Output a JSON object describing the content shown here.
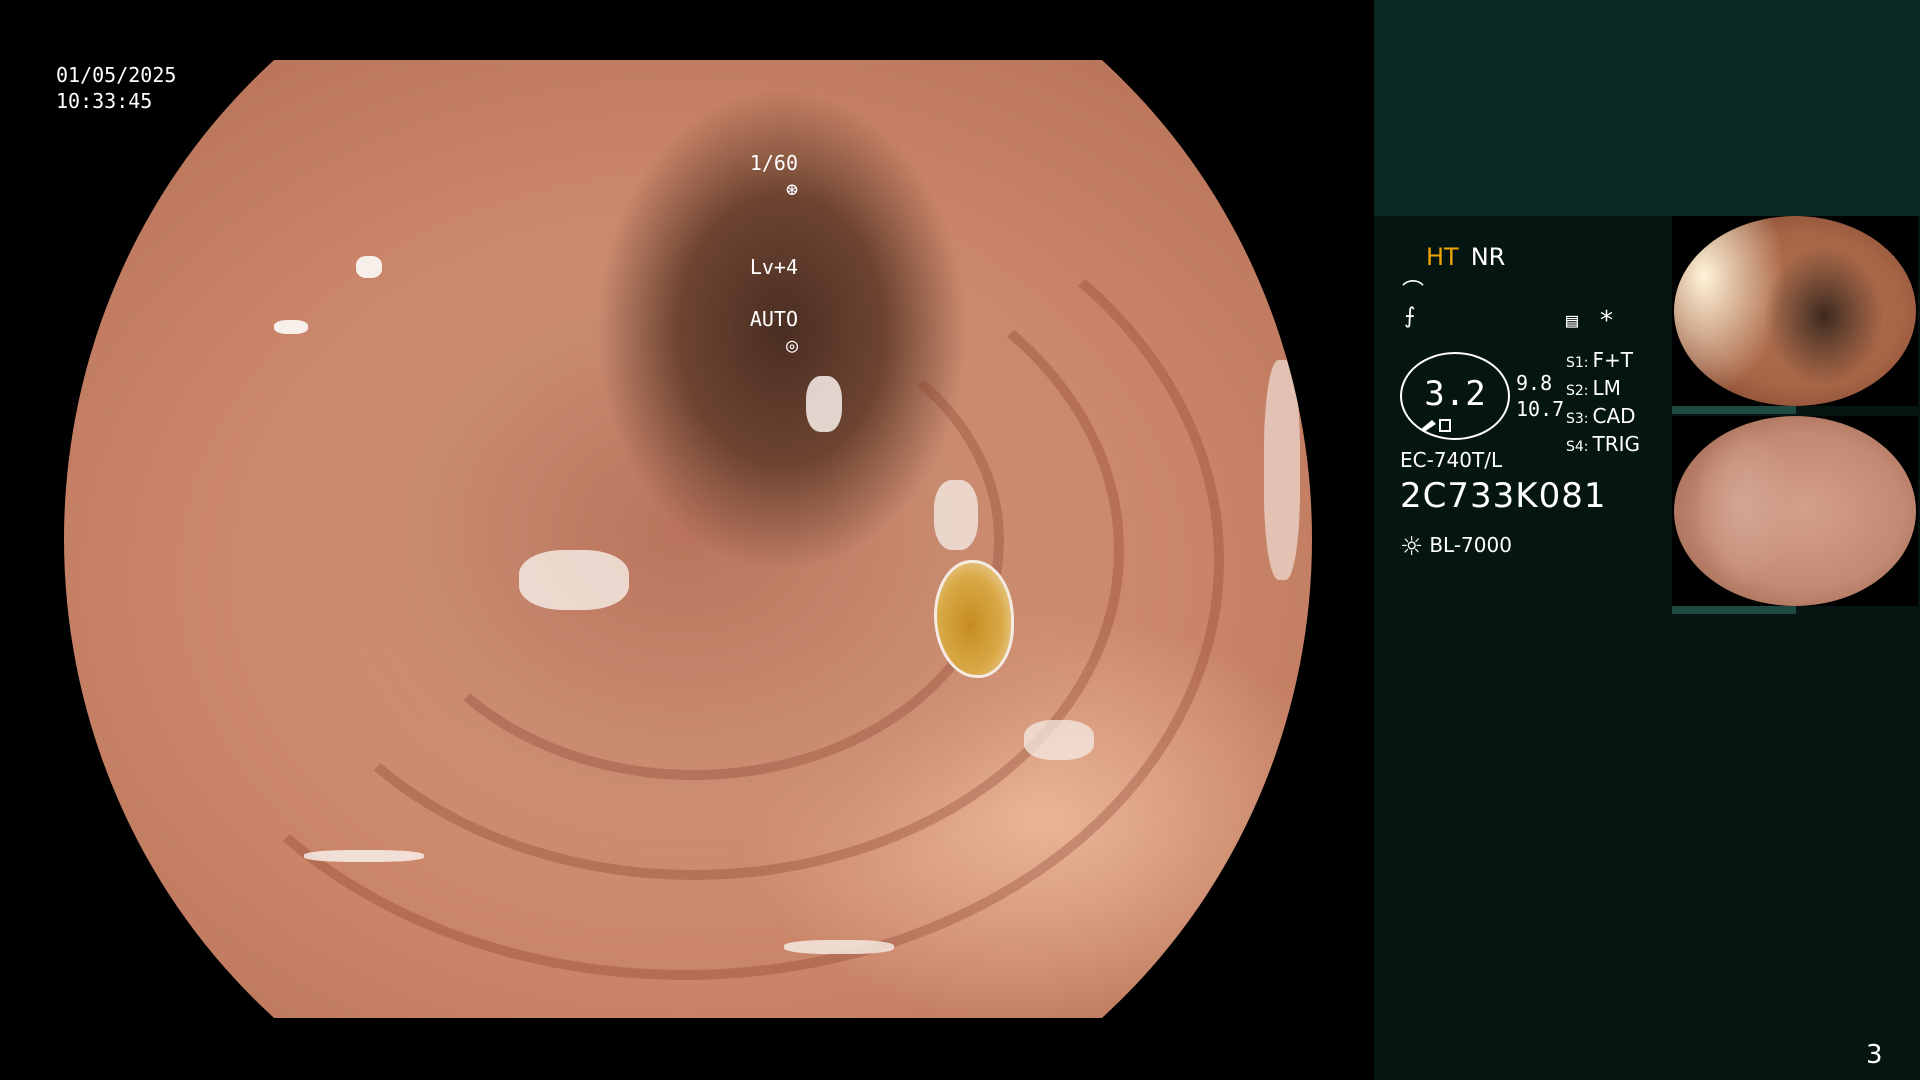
{
  "overlay": {
    "date": "01/05/2025",
    "time": "10:33:45",
    "shutter": "1/60",
    "shutter_icon": "aperture-icon",
    "level": "Lv+4",
    "auto": "AUTO",
    "auto_icon": "target-icon"
  },
  "panel": {
    "mode_ht": "HT",
    "mode_nr": "NR",
    "glyph_1": "⌒",
    "glyph_2": "⨍",
    "gauge_value": "3.2",
    "side_value_1": "9.8",
    "side_value_2": "10.7",
    "settings": [
      {
        "key": "S1:",
        "value": "F+T"
      },
      {
        "key": "S2:",
        "value": "LM"
      },
      {
        "key": "S3:",
        "value": "CAD"
      },
      {
        "key": "S4:",
        "value": "TRIG"
      }
    ],
    "model": "EC-740T/L",
    "serial": "2C733K081",
    "light_source": "BL-7000",
    "page_number": "3"
  },
  "colors": {
    "background": "#000000",
    "panel": "#051612",
    "panel_top": "#0b2723",
    "ht_accent": "#f1a400"
  }
}
